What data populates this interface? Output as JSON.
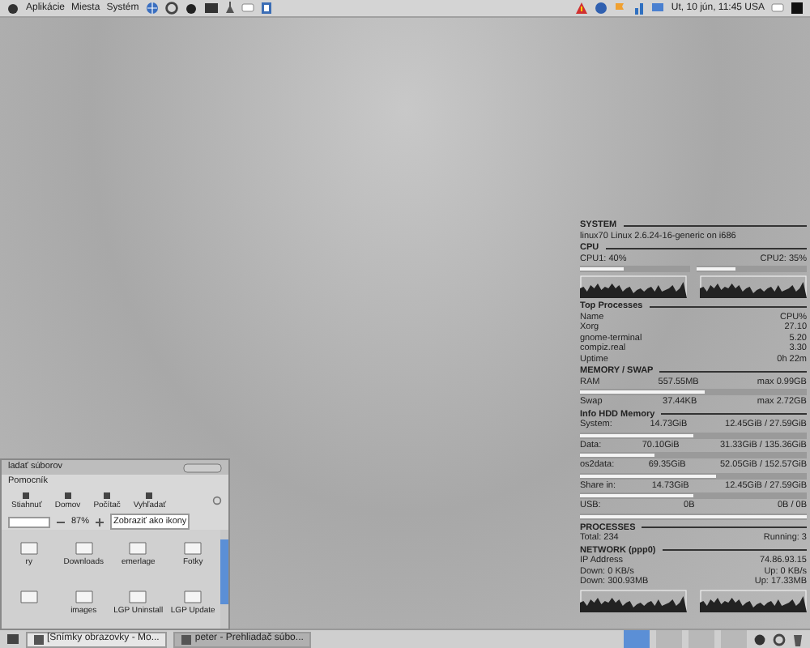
{
  "top_panel": {
    "menus": [
      "Aplikácie",
      "Miesta",
      "Systém"
    ],
    "clock": "Ut, 10 jún, 11:45 USA"
  },
  "conky": [
    {
      "kind": "heading",
      "text": "SYSTEM"
    },
    {
      "kind": "row",
      "cells": [
        "linux70 Linux 2.6.24-16-generic on i686"
      ]
    },
    {
      "kind": "heading",
      "text": "CPU"
    },
    {
      "kind": "row",
      "cells": [
        "CPU1: 40%",
        "CPU2: 35%"
      ]
    },
    {
      "kind": "bars",
      "meters": [
        {
          "level": 0.4
        },
        {
          "level": 0.35
        }
      ]
    },
    {
      "kind": "graphs"
    },
    {
      "kind": "heading",
      "text": "Top Processes"
    },
    {
      "kind": "row",
      "cells": [
        "Name",
        "CPU%"
      ]
    },
    {
      "kind": "row",
      "cells": [
        "Xorg",
        "27.10"
      ]
    },
    {
      "kind": "row",
      "cells": [
        "gnome-terminal",
        "5.20"
      ]
    },
    {
      "kind": "row",
      "cells": [
        "compiz.real",
        "3.30"
      ]
    },
    {
      "kind": "row",
      "cells": [
        "Uptime",
        "0h 22m"
      ]
    },
    {
      "kind": "heading",
      "text": "MEMORY / SWAP"
    },
    {
      "kind": "row",
      "cells": [
        "RAM",
        "557.55MB",
        "max 0.99GB"
      ]
    },
    {
      "kind": "bar",
      "level": 0.55
    },
    {
      "kind": "row",
      "cells": [
        "Swap",
        "37.44KB",
        "max 2.72GB"
      ]
    },
    {
      "kind": "heading",
      "text": "Info HDD Memory"
    },
    {
      "kind": "row",
      "cells": [
        "System:",
        "14.73GiB",
        "12.45GiB / 27.59GiB"
      ]
    },
    {
      "kind": "bar",
      "level": 0.5
    },
    {
      "kind": "row",
      "cells": [
        "Data:",
        "70.10GiB",
        "31.33GiB / 135.36GiB"
      ]
    },
    {
      "kind": "bar",
      "level": 0.33
    },
    {
      "kind": "row",
      "cells": [
        "os2data:",
        "69.35GiB",
        "52.05GiB / 152.57GiB"
      ]
    },
    {
      "kind": "bar",
      "level": 0.6
    },
    {
      "kind": "row",
      "cells": [
        "Share in:",
        "14.73GiB",
        "12.45GiB / 27.59GiB"
      ]
    },
    {
      "kind": "bar",
      "level": 0.5
    },
    {
      "kind": "row",
      "cells": [
        "USB:",
        "0B",
        "0B / 0B"
      ]
    },
    {
      "kind": "bar",
      "level": 1
    },
    {
      "kind": "heading",
      "text": "PROCESSES"
    },
    {
      "kind": "row",
      "cells": [
        "Total: 234",
        "Running: 3"
      ]
    },
    {
      "kind": "heading",
      "text": "NETWORK (ppp0)"
    },
    {
      "kind": "row",
      "cells": [
        "IP Address",
        "74.86.93.15"
      ]
    },
    {
      "kind": "row",
      "cells": [
        "Down: 0 KB/s",
        "Up: 0 KB/s"
      ]
    },
    {
      "kind": "row",
      "cells": [
        "Down: 300.93MB",
        "Up: 17.33MB"
      ]
    },
    {
      "kind": "graphs"
    }
  ],
  "file_window": {
    "title": "ladať súborov",
    "menu": [
      "Pomocník"
    ],
    "toolbar": [
      "Stiahnuť",
      "Domov",
      "Počítač",
      "Vyhľadať"
    ],
    "zoom": "87%",
    "view": "Zobraziť ako ikony",
    "items": [
      {
        "kind": "folder",
        "label": "ry"
      },
      {
        "kind": "folder",
        "label": "Downloads"
      },
      {
        "kind": "folder",
        "label": "emerlage"
      },
      {
        "kind": "folder",
        "label": "Fotky"
      },
      {
        "kind": "folder"
      },
      {
        "kind": "folder",
        "label": "images"
      },
      {
        "kind": "folder",
        "label": "LGP Uninstall"
      },
      {
        "kind": "folder",
        "label": "LGP Update"
      }
    ]
  },
  "taskbar": [
    {
      "label": "[Snímky obrazovky - Mo...",
      "selected": false
    },
    {
      "label": "peter - Prehliadač súbo...",
      "selected": true
    }
  ],
  "workspaces": [
    {
      "selected": true
    },
    {
      "selected": false
    },
    {
      "selected": false
    },
    {
      "selected": false
    }
  ]
}
